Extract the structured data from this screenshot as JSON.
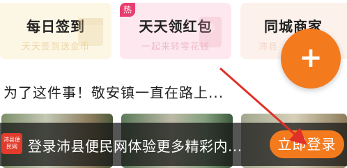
{
  "cards": [
    {
      "title": "每日签到",
      "subtitle": "天天签到送金币"
    },
    {
      "title": "天天领红包",
      "subtitle": "一起来转零花钱",
      "badge": "热"
    },
    {
      "title": "同城商家",
      "subtitle": "沛县"
    }
  ],
  "fab": {
    "label": "+"
  },
  "headline": "为了这件事！敬安镇一直在路上...",
  "banner": {
    "logo_text": "沛县便民网",
    "text": "登录沛县便民网体验更多精彩内...",
    "login_button": "立即登录"
  },
  "colors": {
    "accent": "#f47a1e",
    "hot_badge": "#e83e6f",
    "arrow": "#e0302a"
  }
}
